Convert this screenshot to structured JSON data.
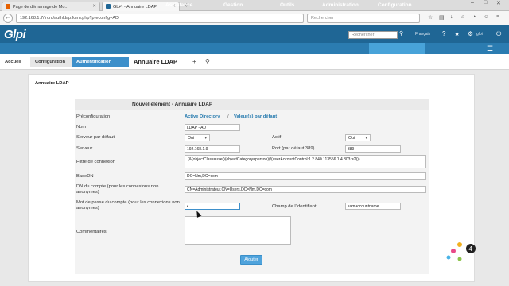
{
  "browser": {
    "tabs": [
      {
        "label": "Page de démarrage de Mo..."
      },
      {
        "label": "GLPI - Annuaire LDAP"
      }
    ],
    "new_tab": "+",
    "url": "192.168.1.7/front/authldap.form.php?preconfig=AD",
    "search_placeholder": "Rechercher"
  },
  "app": {
    "logo": "Glpi",
    "search_placeholder": "Rechercher",
    "language": "Français",
    "user": "glpi",
    "menu": [
      "Parc",
      "Assistance",
      "Gestion",
      "Outils",
      "Administration",
      "Configuration"
    ]
  },
  "breadcrumb": [
    "Accueil",
    "Configuration",
    "Authentification",
    "Annuaire LDAP"
  ],
  "panel_title": "Annuaire LDAP",
  "form": {
    "header": "Nouvel élément - Annuaire LDAP",
    "preconfig_label": "Préconfiguration",
    "preconfig_ad": "Active Directory",
    "preconfig_sep": "/",
    "preconfig_default": "Valeur(s) par défaut",
    "name_label": "Nom",
    "name_value": "LDAP - AD",
    "default_server_label": "Serveur par défaut",
    "default_server_value": "Oui",
    "active_label": "Actif",
    "active_value": "Oui",
    "server_label": "Serveur",
    "server_value": "192.168.1.9",
    "port_label": "Port (par défaut 389)",
    "port_value": "389",
    "filter_label": "Filtre de connexion",
    "filter_value": "(&(objectClass=user)(objectCategory=person)(!(userAccountControl:1.2.840.113556.1.4.803:=2)))",
    "basedn_label": "BaseDN",
    "basedn_value": "DC=Nm,DC=com",
    "account_dn_label": "DN du compte (pour les connexions non anonymes)",
    "account_dn_value": "CN=Administrateur,CN=Users,DC=Nm,DC=com",
    "password_label": "Mot de passe du compte (pour les connexions non anonymes)",
    "password_value": "•",
    "login_field_label": "Champ de l'identifiant",
    "login_field_value": "samaccountname",
    "comments_label": "Commentaires",
    "comments_value": "",
    "submit_label": "Ajouter"
  },
  "colors": {
    "header": "#1f6695",
    "menubar": "#2b7cb1",
    "accent": "#3d8fca"
  }
}
